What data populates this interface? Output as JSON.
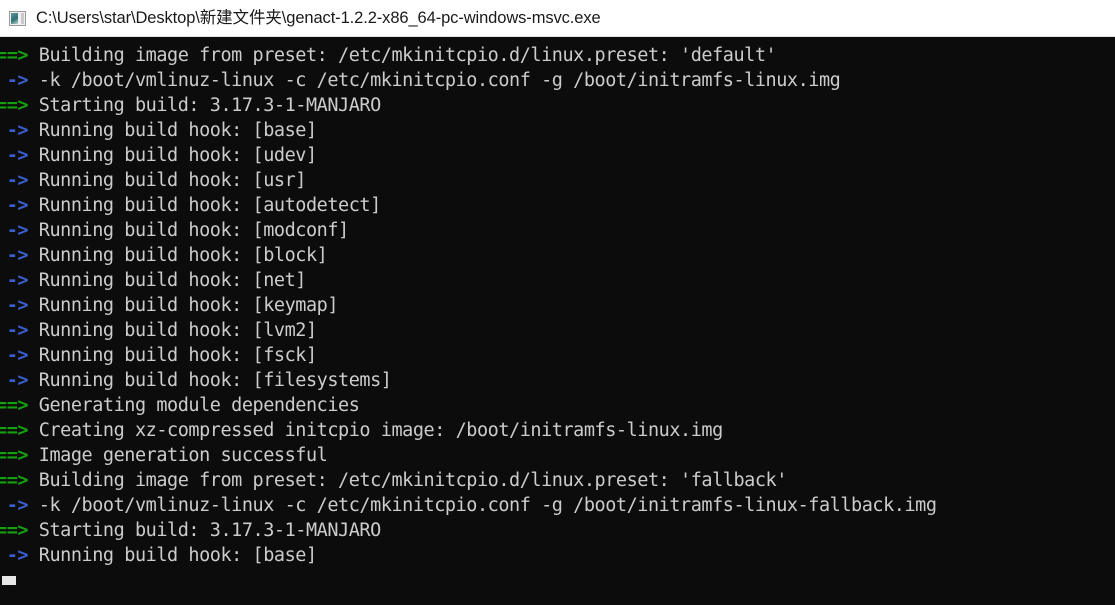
{
  "window": {
    "title": "C:\\Users\\star\\Desktop\\新建文件夹\\genact-1.2.2-x86_64-pc-windows-msvc.exe",
    "icon": "console-window-icon",
    "background_color": "#0c0c0c",
    "titlebar_color": "#ffffff"
  },
  "colors": {
    "text": "#cccccc",
    "arrow_major": "#13a10e",
    "arrow_minor": "#3b5fcf",
    "cursor": "#e8e8e8"
  },
  "terminal": {
    "cursor_visible": true,
    "lines": [
      {
        "prefix": "==>",
        "prefix_kind": "arrow-major",
        "text": " Building image from preset: /etc/mkinitcpio.d/linux.preset: 'default'"
      },
      {
        "prefix": " ->",
        "prefix_kind": "arrow-minor",
        "text": " -k /boot/vmlinuz-linux -c /etc/mkinitcpio.conf -g /boot/initramfs-linux.img"
      },
      {
        "prefix": "==>",
        "prefix_kind": "arrow-major",
        "text": " Starting build: 3.17.3-1-MANJARO"
      },
      {
        "prefix": " ->",
        "prefix_kind": "arrow-minor",
        "text": " Running build hook: [base]"
      },
      {
        "prefix": " ->",
        "prefix_kind": "arrow-minor",
        "text": " Running build hook: [udev]"
      },
      {
        "prefix": " ->",
        "prefix_kind": "arrow-minor",
        "text": " Running build hook: [usr]"
      },
      {
        "prefix": " ->",
        "prefix_kind": "arrow-minor",
        "text": " Running build hook: [autodetect]"
      },
      {
        "prefix": " ->",
        "prefix_kind": "arrow-minor",
        "text": " Running build hook: [modconf]"
      },
      {
        "prefix": " ->",
        "prefix_kind": "arrow-minor",
        "text": " Running build hook: [block]"
      },
      {
        "prefix": " ->",
        "prefix_kind": "arrow-minor",
        "text": " Running build hook: [net]"
      },
      {
        "prefix": " ->",
        "prefix_kind": "arrow-minor",
        "text": " Running build hook: [keymap]"
      },
      {
        "prefix": " ->",
        "prefix_kind": "arrow-minor",
        "text": " Running build hook: [lvm2]"
      },
      {
        "prefix": " ->",
        "prefix_kind": "arrow-minor",
        "text": " Running build hook: [fsck]"
      },
      {
        "prefix": " ->",
        "prefix_kind": "arrow-minor",
        "text": " Running build hook: [filesystems]"
      },
      {
        "prefix": "==>",
        "prefix_kind": "arrow-major",
        "text": " Generating module dependencies"
      },
      {
        "prefix": "==>",
        "prefix_kind": "arrow-major",
        "text": " Creating xz-compressed initcpio image: /boot/initramfs-linux.img"
      },
      {
        "prefix": "==>",
        "prefix_kind": "arrow-major",
        "text": " Image generation successful"
      },
      {
        "prefix": "==>",
        "prefix_kind": "arrow-major",
        "text": " Building image from preset: /etc/mkinitcpio.d/linux.preset: 'fallback'"
      },
      {
        "prefix": " ->",
        "prefix_kind": "arrow-minor",
        "text": " -k /boot/vmlinuz-linux -c /etc/mkinitcpio.conf -g /boot/initramfs-linux-fallback.img"
      },
      {
        "prefix": "==>",
        "prefix_kind": "arrow-major",
        "text": " Starting build: 3.17.3-1-MANJARO"
      },
      {
        "prefix": " ->",
        "prefix_kind": "arrow-minor",
        "text": " Running build hook: [base]"
      }
    ]
  }
}
